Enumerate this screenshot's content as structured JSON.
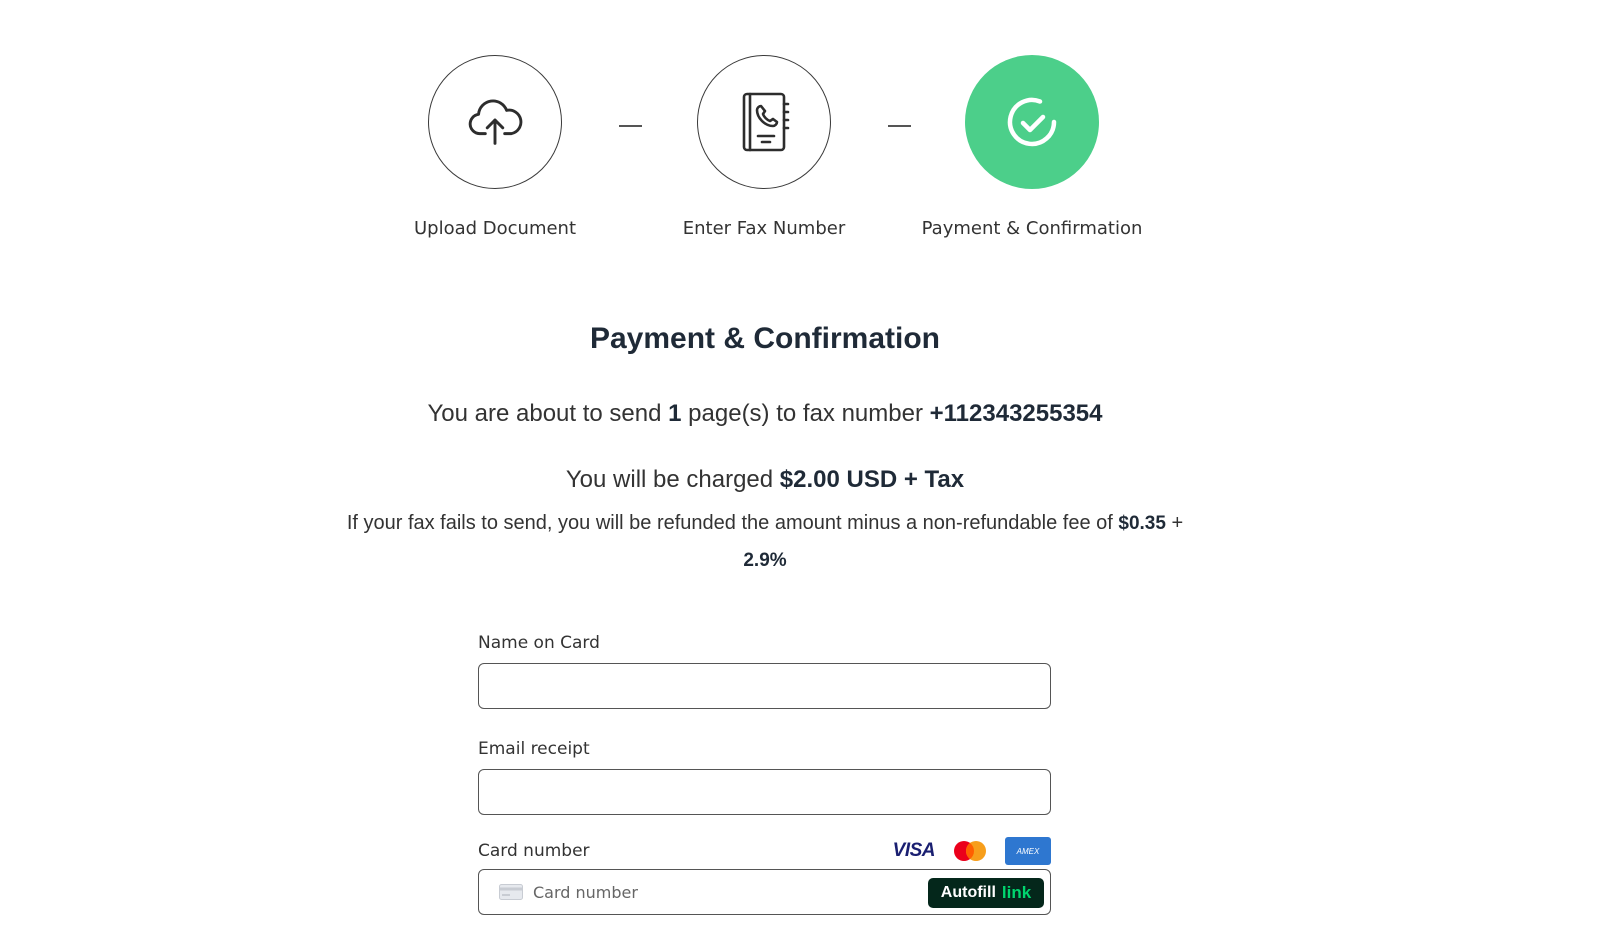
{
  "stepper": {
    "steps": [
      {
        "label": "Upload Document",
        "icon": "cloud-upload-icon",
        "state": "completed"
      },
      {
        "label": "Enter Fax Number",
        "icon": "phone-book-icon",
        "state": "completed"
      },
      {
        "label": "Payment & Confirmation",
        "icon": "check-circle-icon",
        "state": "active"
      }
    ],
    "active_color": "#4ccf8a"
  },
  "page_title": "Payment & Confirmation",
  "summary": {
    "send_prefix": "You are about to send",
    "pages": "1",
    "send_middle": "page(s) to fax number",
    "fax_number": "+112343255354",
    "charge_prefix": "You will be charged",
    "charge_amount": "$2.00 USD + Tax",
    "refund_text": "If your fax fails to send, you will be refunded the amount minus a non-refundable fee of",
    "refund_fee": "$0.35",
    "refund_plus": "+",
    "refund_percent": "2.9%"
  },
  "form": {
    "name_label": "Name on Card",
    "name_value": "",
    "email_label": "Email receipt",
    "email_value": "",
    "card_label": "Card number",
    "card_placeholder": "Card number",
    "card_brands": {
      "visa": "VISA",
      "mastercard": "mastercard",
      "amex": "AMEX"
    },
    "autofill_label": "Autofill",
    "autofill_brand": "link"
  }
}
